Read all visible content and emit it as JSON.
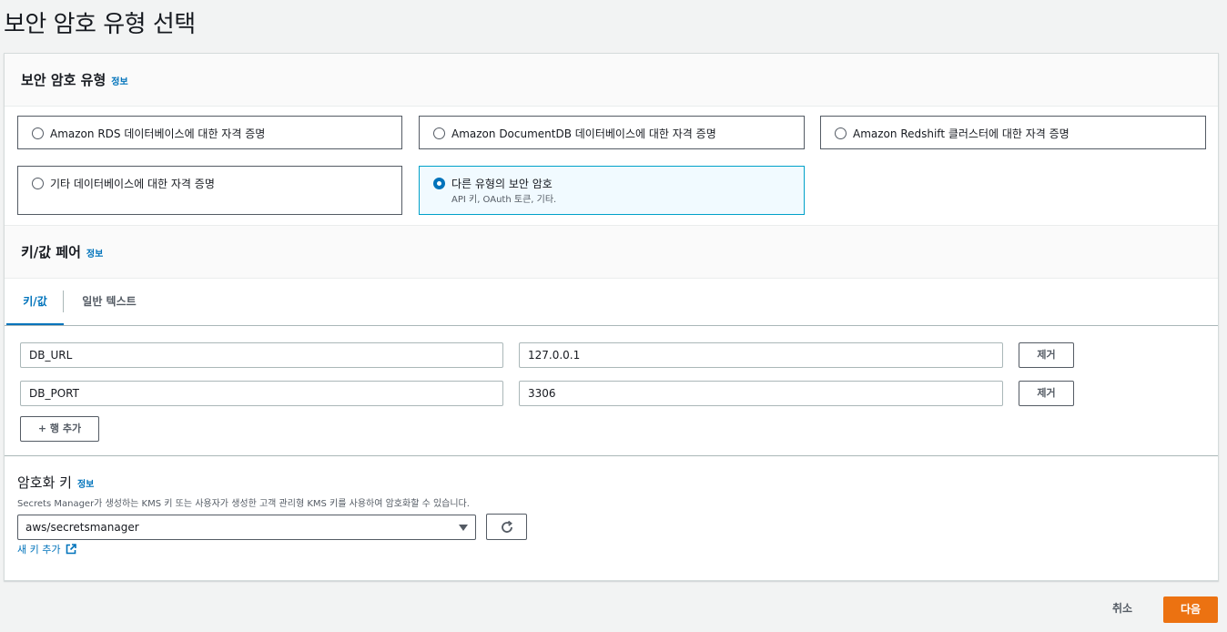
{
  "page": {
    "title": "보안 암호 유형 선택"
  },
  "secret_type": {
    "title": "보안 암호 유형",
    "info": "정보",
    "options": [
      {
        "label": "Amazon RDS 데이터베이스에 대한 자격 증명",
        "selected": false
      },
      {
        "label": "Amazon DocumentDB 데이터베이스에 대한 자격 증명",
        "selected": false
      },
      {
        "label": "Amazon Redshift 클러스터에 대한 자격 증명",
        "selected": false
      },
      {
        "label": "기타 데이터베이스에 대한 자격 증명",
        "selected": false
      },
      {
        "label": "다른 유형의 보안 암호",
        "description": "API 키, OAuth 토큰, 기타.",
        "selected": true
      }
    ]
  },
  "kv": {
    "title": "키/값 페어",
    "info": "정보",
    "tabs": [
      {
        "label": "키/값",
        "active": true
      },
      {
        "label": "일반 텍스트",
        "active": false
      }
    ],
    "rows": [
      {
        "key": "DB_URL",
        "value": "127.0.0.1",
        "remove_label": "제거"
      },
      {
        "key": "DB_PORT",
        "value": "3306",
        "remove_label": "제거"
      }
    ],
    "add_row_label": "+ 행 추가"
  },
  "encryption": {
    "title": "암호화 키",
    "info": "정보",
    "description": "Secrets Manager가 생성하는 KMS 키 또는 사용자가 생성한 고객 관리형 KMS 키를 사용하여 암호화할 수 있습니다.",
    "selected_key": "aws/secretsmanager",
    "refresh_icon": "refresh-icon",
    "new_key_label": "새 키 추가",
    "external_icon": "external-link-icon"
  },
  "footer": {
    "cancel_label": "취소",
    "next_label": "다음"
  },
  "colors": {
    "accent": "#0073bb",
    "primary_button": "#ec7211",
    "selected_tile_bg": "#f1faff"
  }
}
